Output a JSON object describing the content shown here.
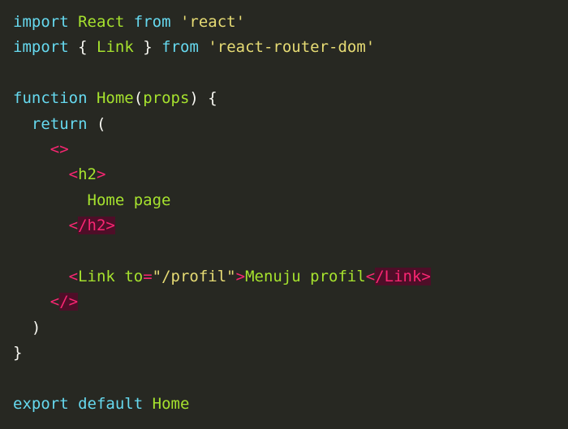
{
  "code": {
    "line1": {
      "kw1": "import",
      "name": "React",
      "kw2": "from",
      "str": "'react'"
    },
    "line2": {
      "kw1": "import",
      "brace_open": "{",
      "name": "Link",
      "brace_close": "}",
      "kw2": "from",
      "str": "'react-router-dom'"
    },
    "line4": {
      "kw": "function",
      "name": "Home",
      "paren_open": "(",
      "param": "props",
      "paren_close": ")",
      "brace": "{"
    },
    "line5": {
      "kw": "return",
      "paren": "("
    },
    "line6": {
      "open": "<>"
    },
    "line7": {
      "lt": "<",
      "tag": "h2",
      "gt": ">"
    },
    "line8": {
      "text": "Home page"
    },
    "line9": {
      "lt": "<",
      "close": "/h2>"
    },
    "line11": {
      "lt": "<",
      "tag": "Link",
      "attr": "to",
      "eq": "=",
      "value": "\"/profil\"",
      "gt": ">",
      "text": "Menuju profil",
      "close_lt": "<",
      "close": "/Link>"
    },
    "line12": {
      "lt": "<",
      "close": "/>"
    },
    "line13": {
      "paren": ")"
    },
    "line14": {
      "brace": "}"
    },
    "line16": {
      "kw1": "export",
      "kw2": "default",
      "name": "Home"
    }
  },
  "colors": {
    "background": "#272822",
    "keyword": "#66d9ef",
    "name": "#a6e22e",
    "string": "#e6db74",
    "plain": "#f8f8f2",
    "tag": "#f92672",
    "error_bg": "#4e0e28"
  }
}
